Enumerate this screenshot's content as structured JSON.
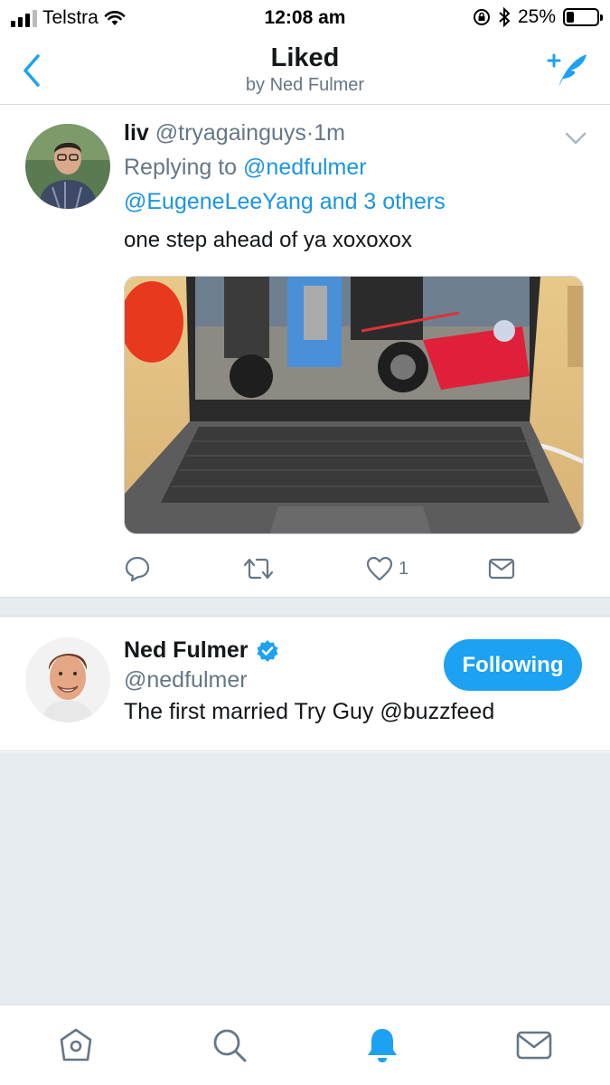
{
  "status_bar": {
    "carrier": "Telstra",
    "time": "12:08 am",
    "battery": "25%",
    "battery_level": 0.25
  },
  "nav": {
    "title": "Liked",
    "subtitle": "by Ned Fulmer",
    "back_icon": "chevron-left-icon",
    "compose_icon": "compose-tweet-icon"
  },
  "tweet": {
    "name": "liv",
    "handle": "@tryagainguys",
    "separator": "·",
    "time": "1m",
    "replying_prefix": "Replying to",
    "reply_mention_1": "@nedfulmer",
    "reply_mention_2": "@EugeneLeeYang and 3 others",
    "text": "one step ahead of ya xoxoxox",
    "like_count": "1"
  },
  "user_card": {
    "name": "Ned Fulmer",
    "handle": "@nedfulmer",
    "bio": "The first married Try Guy @buzzfeed",
    "follow_label": "Following"
  },
  "colors": {
    "accent": "#1da1f2",
    "link": "#1b95e0",
    "secondary_text": "#657786",
    "background_gray": "#e6ecf0"
  }
}
